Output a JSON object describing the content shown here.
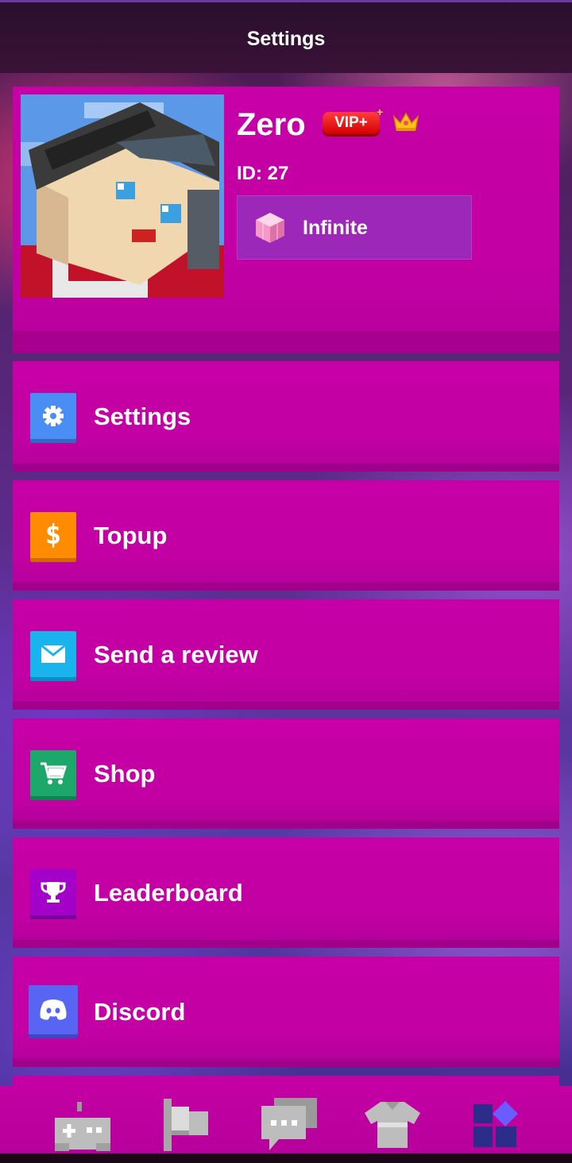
{
  "header": {
    "title": "Settings"
  },
  "profile": {
    "username": "Zero",
    "vip_badge": "VIP+",
    "vip_star": "+",
    "id_text": "ID: 27",
    "currency_label": "Infinite",
    "badge_icon": "crown-icon",
    "currency_icon": "pink-cube-icon"
  },
  "menu": {
    "items": [
      {
        "label": "Settings",
        "icon": "gear-icon",
        "color": "#4a8ef5"
      },
      {
        "label": "Topup",
        "icon": "dollar-icon",
        "color": "#ff8c00"
      },
      {
        "label": "Send a review",
        "icon": "mail-icon",
        "color": "#19b3ee"
      },
      {
        "label": "Shop",
        "icon": "cart-icon",
        "color": "#1ea76a"
      },
      {
        "label": "Leaderboard",
        "icon": "trophy-icon",
        "color": "#a300c9"
      },
      {
        "label": "Discord",
        "icon": "discord-icon",
        "color": "#5865f2"
      }
    ]
  },
  "bottom_nav": {
    "tabs": [
      {
        "icon": "gamepad-icon",
        "active": false
      },
      {
        "icon": "flag-icon",
        "active": false
      },
      {
        "icon": "chat-icon",
        "active": false
      },
      {
        "icon": "shirt-icon",
        "active": false
      },
      {
        "icon": "blocks-icon",
        "active": true
      }
    ]
  },
  "colors": {
    "accent": "#c400a5",
    "topbar": "#2f1030"
  }
}
